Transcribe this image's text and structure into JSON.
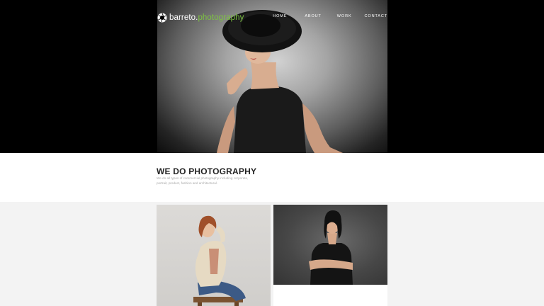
{
  "header": {
    "brand": {
      "name": "barreto",
      "dot": ".",
      "suffix": "photography",
      "accent_color": "#7dc242",
      "icon": "aperture-icon"
    },
    "nav": [
      {
        "label": "HOME"
      },
      {
        "label": "ABOUT"
      },
      {
        "label": "WORK"
      },
      {
        "label": "CONTACT"
      }
    ]
  },
  "intro": {
    "title": "WE DO PHOTOGRAPHY",
    "description": "We do all types of commercial photography including corporate, portrait, product, fashion and architectural."
  },
  "colors": {
    "background": "#f3f3f3",
    "hero_background": "#000000",
    "text_dark": "#222222",
    "text_muted": "#aaaaaa"
  }
}
